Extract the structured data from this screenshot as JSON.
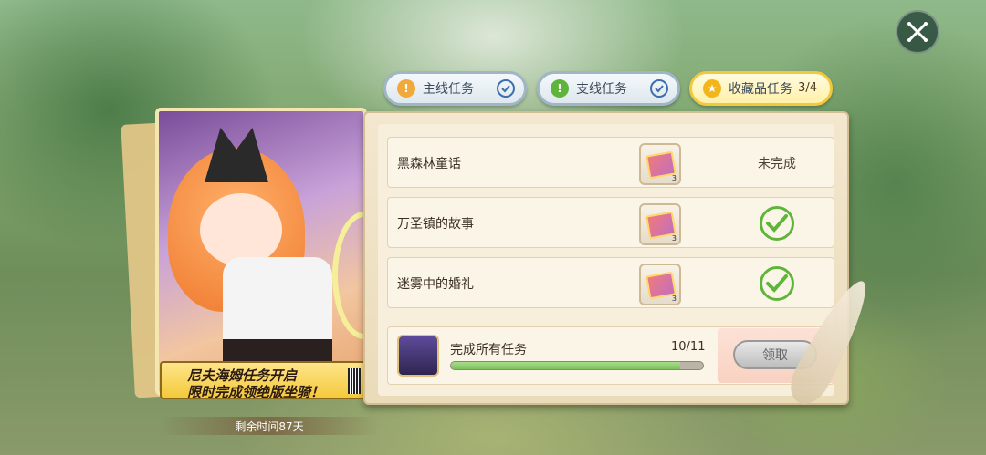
{
  "close_icon": "close-icon",
  "tabs": [
    {
      "label": "主线任务",
      "icon": "info-icon",
      "icon_color": "#f2a93b",
      "checked": true
    },
    {
      "label": "支线任务",
      "icon": "info-icon",
      "icon_color": "#5fb53a",
      "checked": true
    },
    {
      "label": "收藏品任务",
      "icon": "star-icon",
      "icon_color": "#f2b51c",
      "count": "3/4",
      "active": true
    }
  ],
  "quests": [
    {
      "name": "黑森林童话",
      "reward_qty": "3",
      "status": "未完成",
      "done": false
    },
    {
      "name": "万圣镇的故事",
      "reward_qty": "3",
      "status": "",
      "done": true
    },
    {
      "name": "迷雾中的婚礼",
      "reward_qty": "3",
      "status": "",
      "done": true
    }
  ],
  "final_reward": {
    "label": "完成所有任务",
    "progress_text": "10/11",
    "progress": 0.909,
    "claim_label": "领取"
  },
  "banner": {
    "line1": "尼夫海姆任务开启",
    "line2": "限时完成领绝版坐骑！"
  },
  "time_left": "剩余时间87天",
  "colors": {
    "accent_gold": "#f4c93c",
    "check_green": "#5fb53a",
    "panel": "#f3e7cf"
  }
}
